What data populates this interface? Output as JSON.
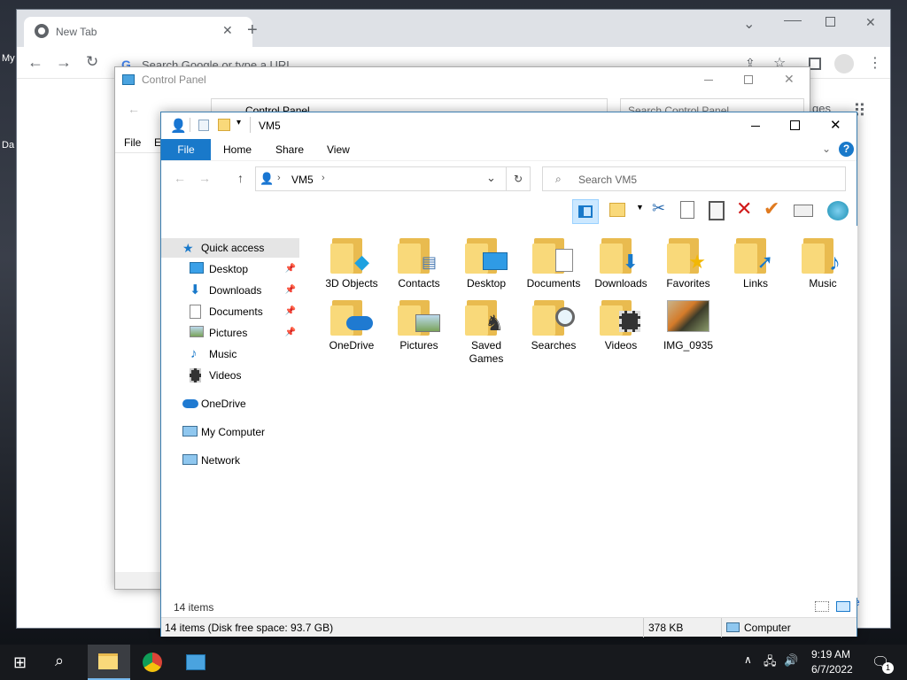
{
  "desktop": {
    "label_1": "My",
    "label_2": "Da"
  },
  "chrome": {
    "tab_title": "New Tab",
    "omnibox_placeholder": "Search Google or type a URL",
    "ntp_link_partial": "ges",
    "side_label_partial": "e"
  },
  "control_panel": {
    "title": "Control Panel",
    "address": "Control Panel",
    "search_placeholder": "Search Control Panel",
    "menu_file": "File",
    "menu_edit": "E"
  },
  "explorer": {
    "title": "VM5",
    "ribbon_tabs": [
      "File",
      "Home",
      "Share",
      "View"
    ],
    "address_segment": "VM5",
    "search_placeholder": "Search VM5",
    "nav": {
      "quick_access": "Quick access",
      "desktop": "Desktop",
      "downloads": "Downloads",
      "documents": "Documents",
      "pictures": "Pictures",
      "music": "Music",
      "videos": "Videos",
      "onedrive": "OneDrive",
      "my_computer": "My Computer",
      "network": "Network"
    },
    "items": [
      {
        "label": "3D Objects",
        "icon": "cube-icon"
      },
      {
        "label": "Contacts",
        "icon": "contact-card-icon"
      },
      {
        "label": "Desktop",
        "icon": "monitor-icon"
      },
      {
        "label": "Documents",
        "icon": "document-icon"
      },
      {
        "label": "Downloads",
        "icon": "download-arrow-icon"
      },
      {
        "label": "Favorites",
        "icon": "star-icon"
      },
      {
        "label": "Links",
        "icon": "link-arrow-icon"
      },
      {
        "label": "Music",
        "icon": "music-note-icon"
      },
      {
        "label": "OneDrive",
        "icon": "cloud-icon"
      },
      {
        "label": "Pictures",
        "icon": "picture-icon"
      },
      {
        "label": "Saved Games",
        "icon": "chess-piece-icon"
      },
      {
        "label": "Searches",
        "icon": "magnifier-icon"
      },
      {
        "label": "Videos",
        "icon": "film-strip-icon"
      },
      {
        "label": "IMG_0935",
        "icon": "tiger-photo-thumbnail"
      }
    ],
    "item_count": "14 items",
    "status_left": "14 items (Disk free space: 93.7 GB)",
    "status_size": "378 KB",
    "status_location": "Computer"
  },
  "taskbar": {
    "time": "9:19 AM",
    "date": "6/7/2022",
    "notification_count": "1"
  },
  "colors": {
    "accent": "#1979ca",
    "folder": "#f9d97a",
    "taskbar": "#17191d"
  }
}
